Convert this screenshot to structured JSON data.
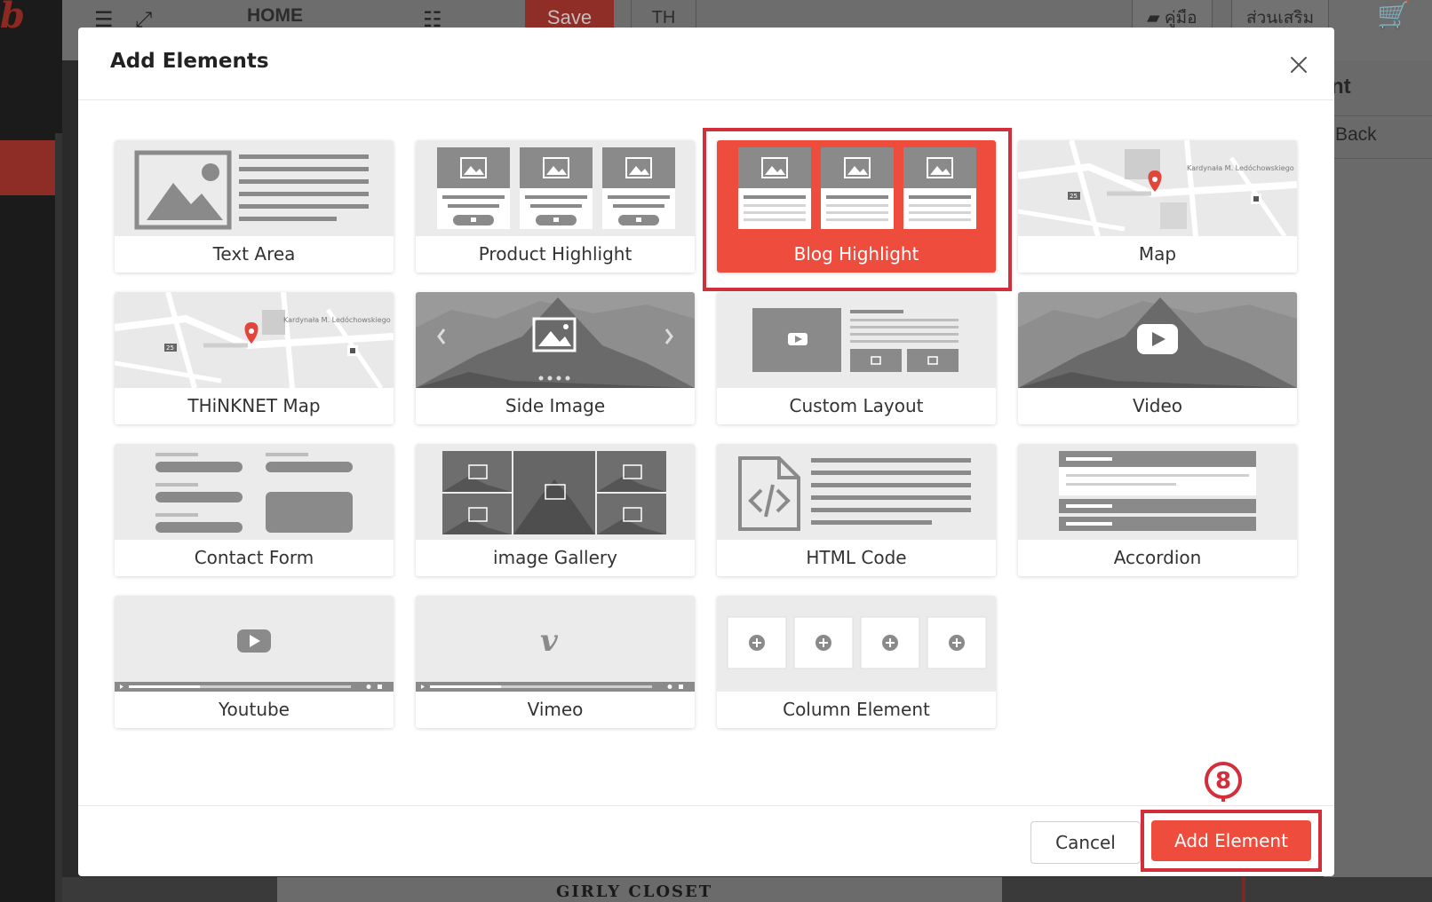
{
  "background": {
    "toolbar": {
      "home_label": "HOME",
      "save_label": "Save",
      "language": "TH",
      "manual_label": "คู่มือ",
      "addons_label": "ส่วนเสริม"
    },
    "side_panel": {
      "title_fragment": "nt",
      "back_label": "Back"
    },
    "footer_fragment": "GIRLY CLOSET"
  },
  "modal": {
    "title": "Add Elements",
    "close_icon": "close-icon",
    "elements": [
      {
        "label": "Text Area",
        "icon": "text-area-thumbnail"
      },
      {
        "label": "Product Highlight",
        "icon": "product-highlight-thumbnail"
      },
      {
        "label": "Blog Highlight",
        "icon": "blog-highlight-thumbnail",
        "selected": true
      },
      {
        "label": "Map",
        "icon": "map-thumbnail"
      },
      {
        "label": "THiNKNET Map",
        "icon": "thinknet-map-thumbnail"
      },
      {
        "label": "Side Image",
        "icon": "side-image-thumbnail"
      },
      {
        "label": "Custom Layout",
        "icon": "custom-layout-thumbnail"
      },
      {
        "label": "Video",
        "icon": "video-thumbnail"
      },
      {
        "label": "Contact Form",
        "icon": "contact-form-thumbnail"
      },
      {
        "label": "image Gallery",
        "icon": "image-gallery-thumbnail"
      },
      {
        "label": "HTML Code",
        "icon": "html-code-thumbnail"
      },
      {
        "label": "Accordion",
        "icon": "accordion-thumbnail"
      },
      {
        "label": "Youtube",
        "icon": "youtube-thumbnail"
      },
      {
        "label": "Vimeo",
        "icon": "vimeo-thumbnail"
      },
      {
        "label": "Column Element",
        "icon": "column-element-thumbnail"
      }
    ],
    "footer": {
      "cancel_label": "Cancel",
      "add_label": "Add Element",
      "step_number": "8"
    }
  },
  "colors": {
    "accent": "#ee4d3e",
    "highlight_frame": "#d32f3a",
    "thumb_gray": "#8a8a8a"
  }
}
